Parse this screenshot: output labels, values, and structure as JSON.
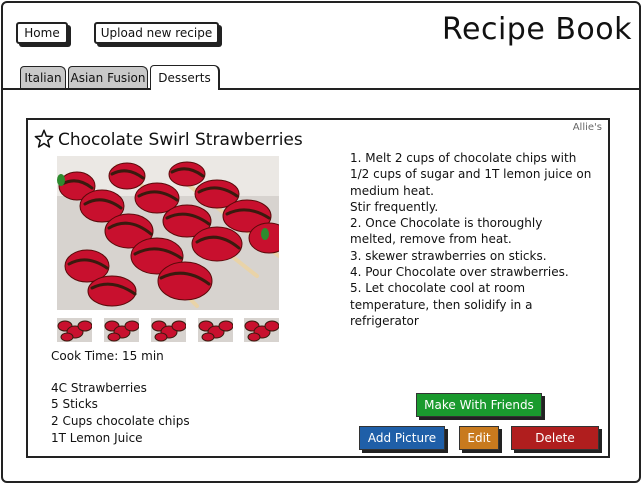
{
  "header": {
    "home_label": "Home",
    "upload_label": "Upload new recipe",
    "app_title": "Recipe Book"
  },
  "tabs": [
    {
      "label": "Italian",
      "active": false
    },
    {
      "label": "Asian Fusion",
      "active": false
    },
    {
      "label": "Desserts",
      "active": true
    }
  ],
  "recipe": {
    "owner": "Allie's",
    "title": "Chocolate Swirl Strawberries",
    "cook_time": "Cook Time: 15 min",
    "ingredients": [
      "4C Strawberries",
      "5 Sticks",
      "2 Cups chocolate chips",
      "1T Lemon Juice"
    ],
    "instructions": [
      "1. Melt 2 cups of chocolate chips with",
      "1/2 cups of sugar and 1T lemon juice on",
      "medium heat.",
      "Stir frequently.",
      "2. Once Chocolate is thoroughly",
      "melted, remove from heat.",
      "3. skewer strawberries on sticks.",
      "4. Pour Chocolate over strawberries.",
      "5. Let chocolate cool at room",
      "temperature, then solidify in a",
      "refrigerator"
    ],
    "thumbnail_count": 5
  },
  "actions": {
    "make_with_friends": "Make With Friends",
    "add_picture": "Add Picture",
    "edit": "Edit",
    "delete": "Delete"
  },
  "colors": {
    "make_with_friends": "#1a9a2e",
    "add_picture": "#1f5fa8",
    "edit": "#c87a1e",
    "delete": "#b01e1e"
  }
}
